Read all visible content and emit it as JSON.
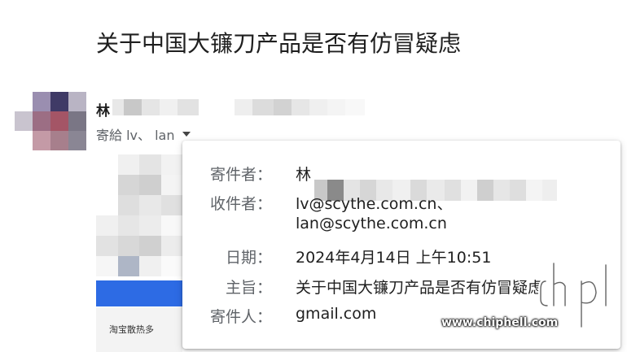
{
  "email": {
    "subject": "关于中国大镰刀产品是否有仿冒疑虑",
    "sender_initial": "林",
    "recipients_line": "寄給 lv、 lan"
  },
  "details_popup": {
    "rows": [
      {
        "label": "寄件者：",
        "value": "林"
      },
      {
        "label": "收件者：",
        "value": "lv@scythe.com.cn、",
        "value2": "lan@scythe.com.cn"
      },
      {
        "label": "日期：",
        "value": "2024年4月14日 上午10:51"
      },
      {
        "label": "主旨：",
        "value": "关于中国大镰刀产品是否有仿冒疑虑"
      },
      {
        "label": "寄件人：",
        "value": "gmail.com"
      }
    ]
  },
  "preview": {
    "footer_text": "淘宝散热多"
  },
  "watermark": {
    "url": "www.chiphell.com",
    "logo_icon": "chiphell-logo-icon"
  },
  "colors": {
    "link_blue": "#2d6be4",
    "label_gray": "#5f6368"
  }
}
